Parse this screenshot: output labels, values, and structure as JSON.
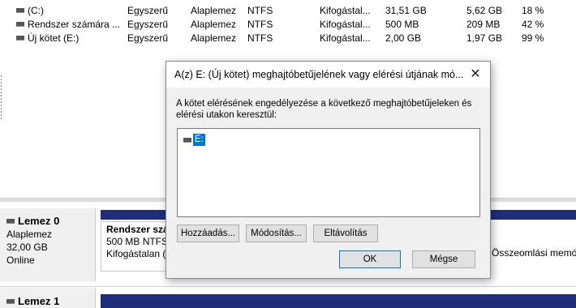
{
  "volumes": [
    {
      "name": "(C:)",
      "layout": "Egyszerű",
      "type": "Alaplemez",
      "fs": "NTFS",
      "status": "Kifogástal...",
      "capacity": "31,51 GB",
      "free": "5,62 GB",
      "pct": "18 %"
    },
    {
      "name": "Rendszer számára ...",
      "layout": "Egyszerű",
      "type": "Alaplemez",
      "fs": "NTFS",
      "status": "Kifogástal...",
      "capacity": "500 MB",
      "free": "209 MB",
      "pct": "42 %"
    },
    {
      "name": "Új kötet (E:)",
      "layout": "Egyszerű",
      "type": "Alaplemez",
      "fs": "NTFS",
      "status": "Kifogástal...",
      "capacity": "2,00 GB",
      "free": "1,97 GB",
      "pct": "99 %"
    }
  ],
  "disks": [
    {
      "title": "Lemez 0",
      "kind": "Alaplemez",
      "size": "32,00 GB",
      "state": "Online"
    },
    {
      "title": "Lemez 1"
    }
  ],
  "partition": {
    "title": "Rendszer szá",
    "line1": "500 MB NTFS",
    "line2": "Kifogástalan ("
  },
  "partition_right": {
    "line": "Összeomlási memó"
  },
  "dialog": {
    "title": "A(z) E: (Új kötet) meghajtóbetűjelének vagy elérési útjának mó...",
    "close": "✕",
    "description": "A kötet elérésének engedélyezése a következő meghajtóbetűjeleken és elérési utakon keresztül:",
    "list_items": [
      "E:"
    ],
    "buttons": {
      "add": "Hozzáadás...",
      "change": "Módosítás...",
      "remove": "Eltávolítás",
      "ok": "OK",
      "cancel": "Mégse"
    }
  },
  "colors": {
    "disk_bar": "#1f2d7a",
    "selection": "#0078d7",
    "dialog_bg": "#f0f0f0"
  }
}
